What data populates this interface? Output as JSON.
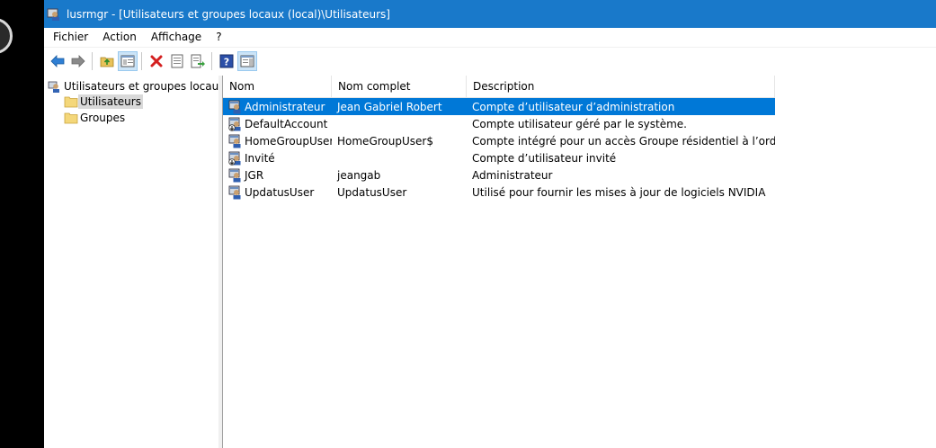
{
  "window": {
    "title": "lusrmgr - [Utilisateurs et groupes locaux (local)\\Utilisateurs]"
  },
  "menu": [
    "Fichier",
    "Action",
    "Affichage",
    "?"
  ],
  "toolbar": {
    "icons": [
      "back-arrow-icon",
      "forward-arrow-icon",
      "up-folder-icon",
      "show-hide-tree-icon",
      "delete-icon",
      "properties-icon",
      "export-list-icon",
      "help-icon",
      "action-pane-icon"
    ]
  },
  "tree": {
    "root": "Utilisateurs et groupes locaux (local)",
    "children": [
      "Utilisateurs",
      "Groupes"
    ],
    "selected": "Utilisateurs"
  },
  "columns": {
    "name": "Nom",
    "fullname": "Nom complet",
    "description": "Description"
  },
  "users": [
    {
      "name": "Administrateur",
      "fullname": "Jean Gabriel Robert",
      "description": "Compte d’utilisateur d’administration",
      "disabled": false
    },
    {
      "name": "DefaultAccount",
      "fullname": "",
      "description": "Compte utilisateur géré par le système.",
      "disabled": true
    },
    {
      "name": "HomeGroupUser$",
      "fullname": "HomeGroupUser$",
      "description": "Compte intégré pour un accès Groupe résidentiel à l’ordinateur",
      "disabled": false
    },
    {
      "name": "Invité",
      "fullname": "",
      "description": "Compte d’utilisateur invité",
      "disabled": true
    },
    {
      "name": "JGR",
      "fullname": "jeangab",
      "description": "Administrateur",
      "disabled": false
    },
    {
      "name": "UpdatusUser",
      "fullname": "UpdatusUser",
      "description": "Utilisé pour fournir les mises à jour de logiciels NVIDIA",
      "disabled": false
    }
  ],
  "selected_row": 0,
  "colors": {
    "titlebar": "#1979ca",
    "selection": "#0078d7",
    "tree_selection": "#d9d9d9"
  }
}
